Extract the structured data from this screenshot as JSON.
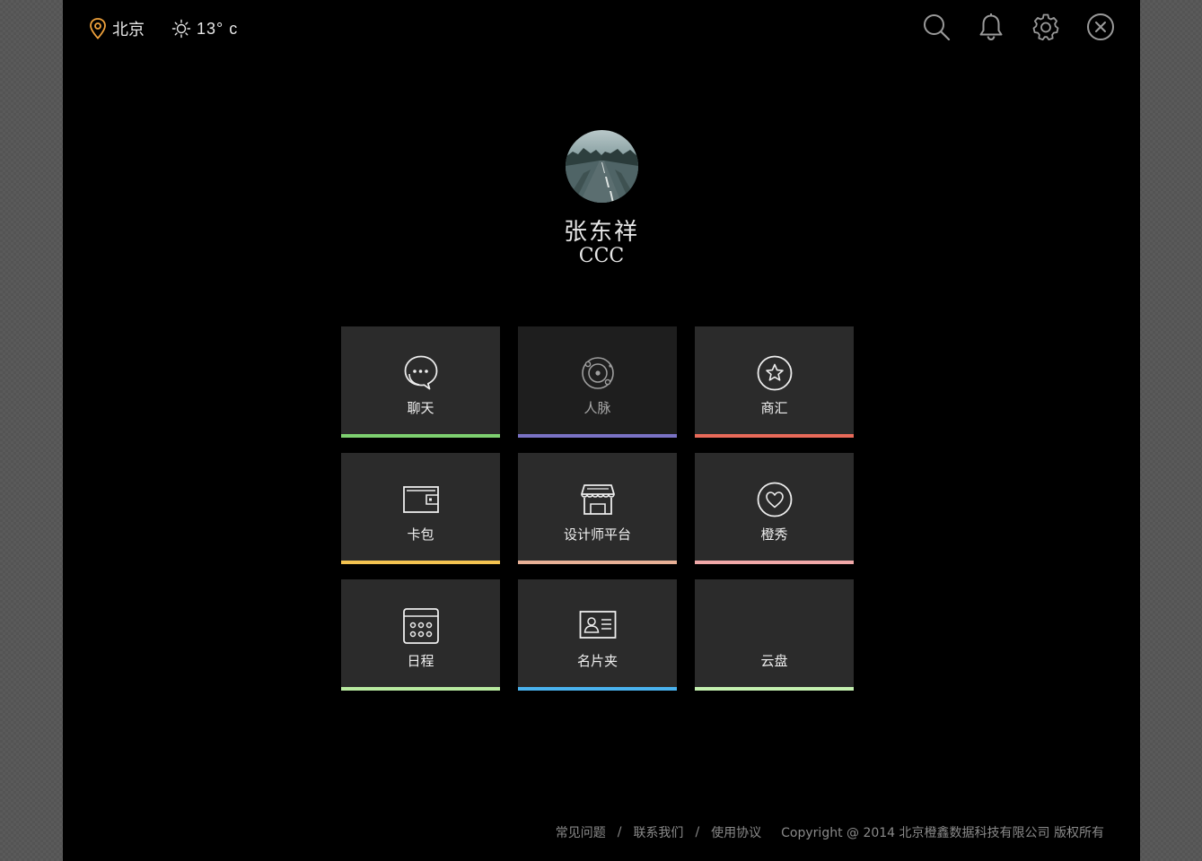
{
  "topbar": {
    "location": "北京",
    "weather": "13° c",
    "icons": [
      "map-pin-icon",
      "sun-icon",
      "search-icon",
      "bell-icon",
      "gear-icon",
      "close-icon"
    ],
    "accent": "#f0a23c"
  },
  "profile": {
    "name": "张东祥",
    "subtitle": "CCC"
  },
  "tiles": [
    {
      "label": "聊天",
      "icon": "chat-bubbles-icon",
      "color": "#7ed070"
    },
    {
      "label": "人脉",
      "icon": "network-orbit-icon",
      "color": "#7a72c4"
    },
    {
      "label": "商汇",
      "icon": "star-circle-icon",
      "color": "#e86a5a"
    },
    {
      "label": "卡包",
      "icon": "wallet-icon",
      "color": "#f4c350"
    },
    {
      "label": "设计师平台",
      "icon": "storefront-icon",
      "color": "#e8b096"
    },
    {
      "label": "橙秀",
      "icon": "heart-circle-icon",
      "color": "#f0a8a8"
    },
    {
      "label": "日程",
      "icon": "calendar-icon",
      "color": "#b8eaa0"
    },
    {
      "label": "名片夹",
      "icon": "id-card-icon",
      "color": "#4ab2ee"
    },
    {
      "label": "云盘",
      "icon": "",
      "color": "#c4f0b0"
    }
  ],
  "footer": {
    "links": [
      "常见问题",
      "联系我们",
      "使用协议"
    ],
    "separator": "/",
    "copyright": "Copyright @ 2014 北京橙鑫数据科技有限公司 版权所有"
  }
}
